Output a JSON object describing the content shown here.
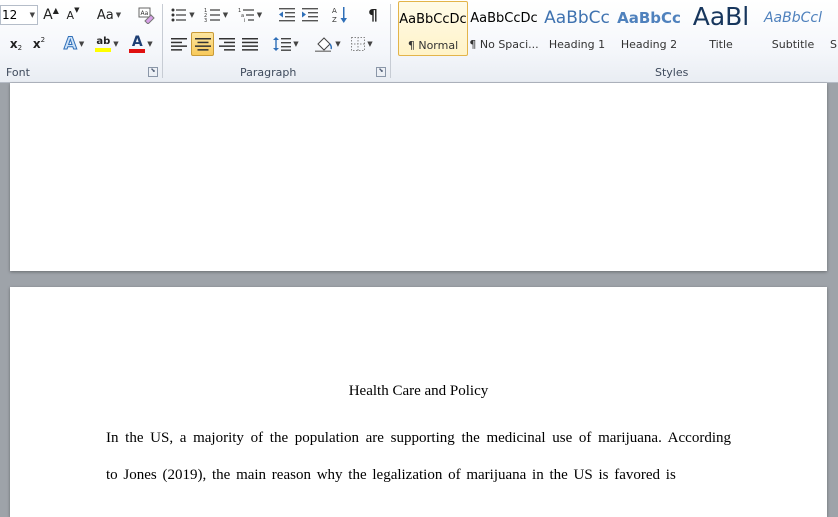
{
  "ribbon": {
    "font": {
      "label": "Font",
      "size_value": "12",
      "grow_label": "A",
      "shrink_label": "A",
      "case_label": "Aa",
      "subscript_label": "x",
      "superscript_label": "x",
      "highlight_label": "ab",
      "fontcolor_label": "A",
      "highlight_color": "#ffff00",
      "fontcolor_color": "#e01010"
    },
    "paragraph": {
      "label": "Paragraph",
      "pilcrow_label": "¶"
    },
    "styles": {
      "label": "Styles",
      "items": [
        {
          "preview": "AaBbCcDc",
          "name": "¶ Normal",
          "selected": true
        },
        {
          "preview": "AaBbCcDc",
          "name": "¶ No Spaci..."
        },
        {
          "preview": "AaBbCc",
          "name": "Heading 1"
        },
        {
          "preview": "AaBbCc",
          "name": "Heading 2"
        },
        {
          "preview": "AaBl",
          "name": "Title"
        },
        {
          "preview": "AaBbCcl",
          "name": "Subtitle"
        },
        {
          "preview": "",
          "name": "S"
        }
      ]
    }
  },
  "document": {
    "title": "Health Care and Policy",
    "lines": [
      "In the US, a majority of the population are supporting the medicinal use of marijuana. According",
      "to Jones (2019), the main reason why the legalization of marijuana in the US is favored is"
    ]
  }
}
